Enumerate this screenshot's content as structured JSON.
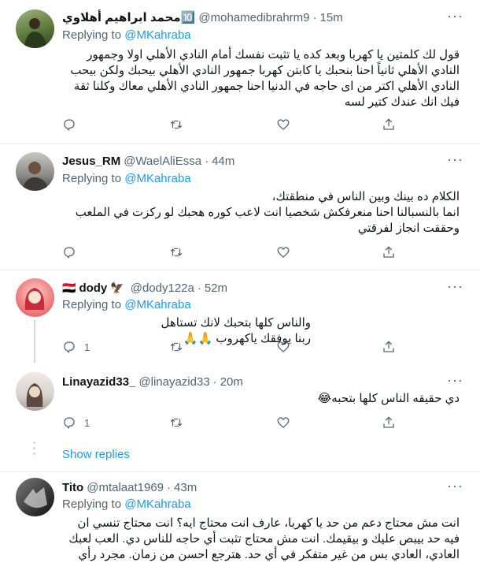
{
  "tweets": [
    {
      "name": "محمد ابراهيم أهلاوي🔟",
      "handle": "@mohamedibrahrm9",
      "time": "15m",
      "replying_prefix": "Replying to ",
      "replying_to": "@MKahraba",
      "text": "قول لك كلمتين يا كهربا وبعد كده يا تثبت نفسك أمام النادي الأهلي اولا وجمهور النادي الأهلي ثانياً احنا بنحبك يا كابتن كهربا جمهور النادي الأهلي بيحبك ولكن بيحب النادي الأهلي اكتر من اى حاجه في الدنيا احنا جمهور النادي الأهلي معاك وكلنا ثقة فيك انك عندك كتير لسه",
      "reply_count": "",
      "avatar_color": "#5d7a3c"
    },
    {
      "name": "Jesus_RM",
      "handle": "@WaelAliEssa",
      "time": "44m",
      "replying_prefix": "Replying to ",
      "replying_to": "@MKahraba",
      "text": "الكلام ده بينك وبين الناس في منطقتك،\nانما بالنسبالنا احنا منعرفكش شخصيا انت لاعب كوره هحبك لو ركزت في الملعب وحققت انجاز لفرقتي",
      "reply_count": "",
      "avatar_color": "#8c8a86"
    },
    {
      "name": "dody",
      "flag": "🇪🇬",
      "badge": "🦅",
      "handle": "@dody122a",
      "time": "52m",
      "replying_prefix": "Replying to ",
      "replying_to": "@MKahraba",
      "text": "والناس كلها بتحبك لانك تستاهل ربنا يوفقك ياكهروب 🙏🙏",
      "reply_count": "1",
      "avatar_color": "#e04a5a"
    },
    {
      "name": "Linayazid33_",
      "handle": "@linayazid33",
      "time": "20m",
      "text": "دي حقيقه الناس كلها بتحبه😂",
      "reply_count": "1",
      "avatar_color": "#d8d3cf"
    },
    {
      "name": "Tito",
      "handle": "@mtalaat1969",
      "time": "43m",
      "replying_prefix": "Replying to ",
      "replying_to": "@MKahraba",
      "text": "انت مش محتاج دعم من حد يا كهربا، عارف انت محتاج ايه؟ انت محتاج تنسي ان فيه حد بيبص عليك و بيقيمك. انت مش محتاج تثبت أي حاجه للناس دي. العب لعبك العادي، العادي بس من غير متفكر في أي حد. هترجع احسن من زمان. مجرد رأي",
      "avatar_color": "#3a3a3a"
    }
  ],
  "show_replies": "Show replies",
  "dot": "·",
  "more": "···",
  "icons": [
    "reply-icon",
    "retweet-icon",
    "like-icon",
    "share-icon",
    "more-icon"
  ]
}
